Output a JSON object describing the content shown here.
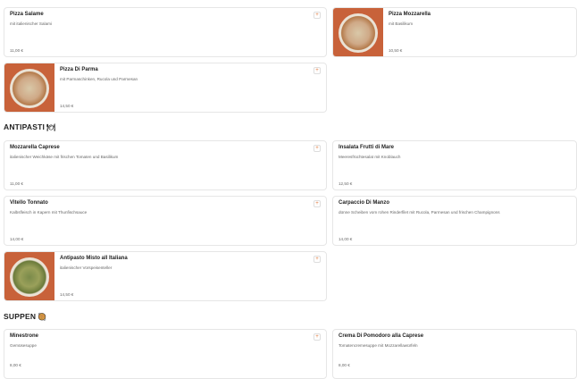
{
  "sections": {
    "antipasti": {
      "label": "ANTIPASTI",
      "emoji": "🍽"
    },
    "suppen": {
      "label": "SUPPEN",
      "emoji": "🥘"
    }
  },
  "add_symbol": "+",
  "items": {
    "pizza_salame": {
      "title": "Pizza Salame",
      "desc": "mit italienischer Salami",
      "price": "11,00 €"
    },
    "pizza_mozzarella": {
      "title": "Pizza Mozzarella",
      "desc": "mit Basilikum",
      "price": "10,50 €"
    },
    "pizza_di_parma": {
      "title": "Pizza Di Parma",
      "desc": "mit Parmaschinken, Rucola und Parmesan",
      "price": "14,50 €"
    },
    "mozzarella_caprese": {
      "title": "Mozzarella Caprese",
      "desc": "italienischer Weichkäse mit frischen Tomaten und Basilikum",
      "price": "11,00 €"
    },
    "insalata_frutti": {
      "title": "Insalata Frutti di Mare",
      "desc": "Meeresfrüchtesalat mit Knoblauch",
      "price": "12,50 €"
    },
    "vitello_tonnato": {
      "title": "Vitello Tonnato",
      "desc": "Kalbsfleisch in Kapern mit Thunfischsauce",
      "price": "14,00 €"
    },
    "carpaccio": {
      "title": "Carpaccio Di Manzo",
      "desc": "dünne Scheiben vom rohen Rinderfilet mit Rucola, Parmesan und frischen Champignons",
      "price": "14,00 €"
    },
    "antipasto_misto": {
      "title": "Antipasto Misto all Italiana",
      "desc": "italienischer Vorspeisenteller",
      "price": "14,50 €"
    },
    "minestrone": {
      "title": "Minestrone",
      "desc": "Gemüsesuppe",
      "price": "8,00 €"
    },
    "crema_pomodoro": {
      "title": "Crema Di Pomodoro alla Caprese",
      "desc": "Tomatencremesuppe mit Mozzarellawürfeln",
      "price": "8,00 €"
    }
  }
}
